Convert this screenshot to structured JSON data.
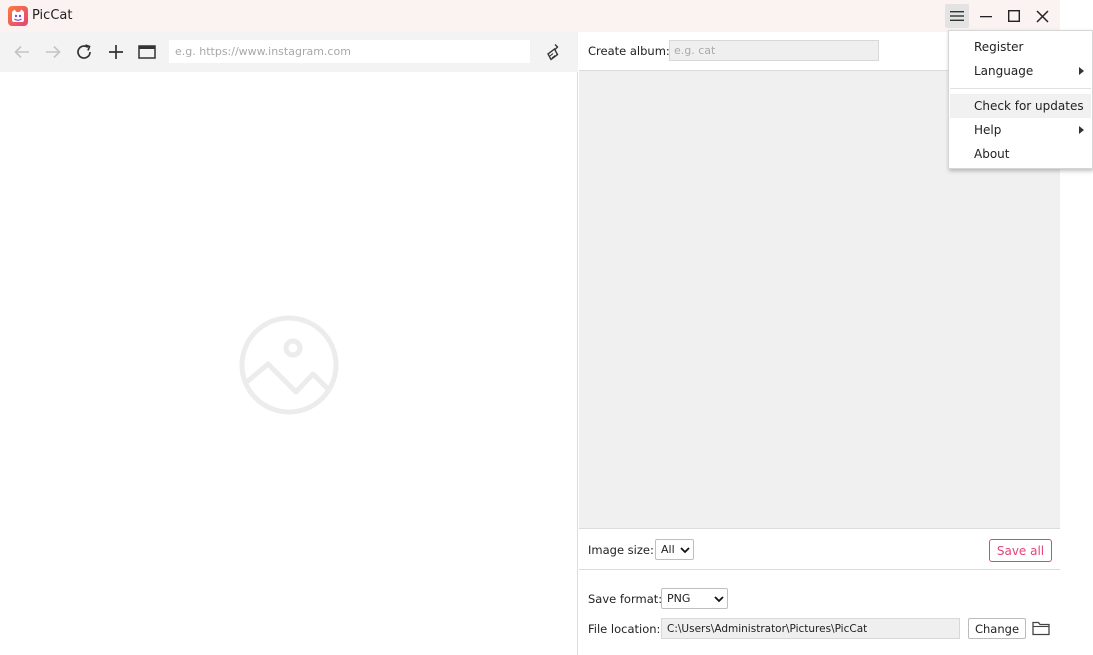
{
  "app": {
    "title": "PicCat"
  },
  "toolbar": {
    "url_placeholder": "e.g. https://www.instagram.com"
  },
  "album": {
    "label": "Create album:",
    "placeholder": "e.g. cat"
  },
  "image_size": {
    "label": "Image size:",
    "selected": "All"
  },
  "save_all_label": "Save all",
  "save_format": {
    "label": "Save format:",
    "selected": "PNG"
  },
  "file_location": {
    "label": "File location:",
    "path": "C:\\Users\\Administrator\\Pictures\\PicCat",
    "change_label": "Change"
  },
  "menu": {
    "items": [
      {
        "label": "Register",
        "submenu": false
      },
      {
        "label": "Language",
        "submenu": true
      },
      {
        "label": "Check for updates",
        "submenu": false
      },
      {
        "label": "Help",
        "submenu": true
      },
      {
        "label": "About",
        "submenu": false
      }
    ]
  },
  "colors": {
    "accent": "#e0457a",
    "titlebar_bg": "#fbf3f1",
    "gallery_bg": "#f0f0f0"
  }
}
